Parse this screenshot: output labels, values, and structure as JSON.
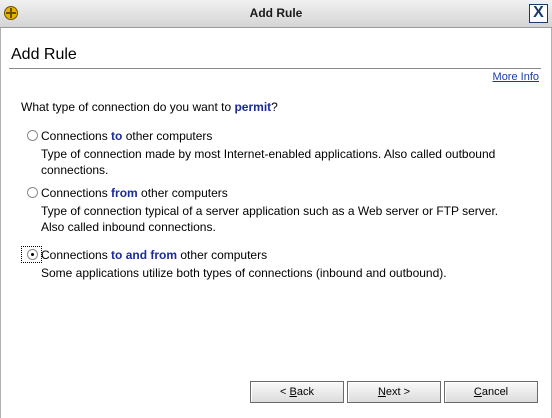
{
  "window": {
    "title": "Add Rule",
    "close_glyph": "X",
    "app_icon": "globe-icon"
  },
  "page": {
    "heading": "Add Rule",
    "more_info": "More Info"
  },
  "question": {
    "prefix": "What type of connection do you want to ",
    "keyword": "permit",
    "suffix": "?"
  },
  "options": [
    {
      "pre": "Connections ",
      "keyword": "to",
      "post": " other computers",
      "description": "Type of connection made by most Internet-enabled applications. Also called outbound connections.",
      "selected": false
    },
    {
      "pre": "Connections ",
      "keyword": "from",
      "post": " other computers",
      "description": "Type of connection typical of a server application such as a Web server or FTP server. Also called inbound connections.",
      "selected": false
    },
    {
      "pre": "Connections ",
      "keyword": "to and from",
      "post": " other computers",
      "description": "Some applications utilize both types of connections (inbound and outbound).",
      "selected": true
    }
  ],
  "buttons": {
    "back": {
      "pre": "< ",
      "mnemonic": "B",
      "post": "ack"
    },
    "next": {
      "pre": "",
      "mnemonic": "N",
      "post": "ext >"
    },
    "cancel": {
      "pre": "",
      "mnemonic": "C",
      "post": "ancel"
    }
  },
  "colors": {
    "keyword": "#1a2a9a",
    "link": "#1a3aa8"
  }
}
